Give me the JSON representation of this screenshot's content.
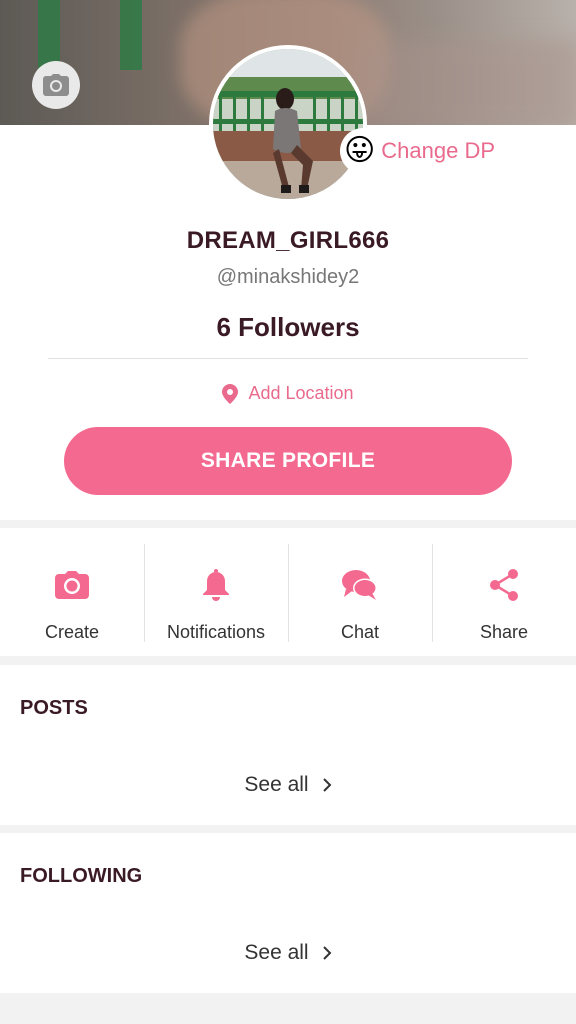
{
  "profile": {
    "username": "DREAM_GIRL666",
    "handle": "@minakshidey2",
    "followers_count": "6",
    "followers_label": "Followers",
    "change_dp_label": "Change DP",
    "change_dp_emoji": "😛",
    "location_label": "Add Location",
    "share_profile_label": "SHARE PROFILE"
  },
  "actions": [
    {
      "label": "Create",
      "icon": "camera-icon"
    },
    {
      "label": "Notifications",
      "icon": "bell-icon"
    },
    {
      "label": "Chat",
      "icon": "chat-bubbles-icon"
    },
    {
      "label": "Share",
      "icon": "share-icon"
    }
  ],
  "sections": {
    "posts": {
      "title": "POSTS",
      "see_all": "See all"
    },
    "following": {
      "title": "FOLLOWING",
      "see_all": "See all"
    }
  },
  "colors": {
    "accent": "#f4698f",
    "accent_text": "#e96a8c",
    "heading": "#3a1a24"
  }
}
